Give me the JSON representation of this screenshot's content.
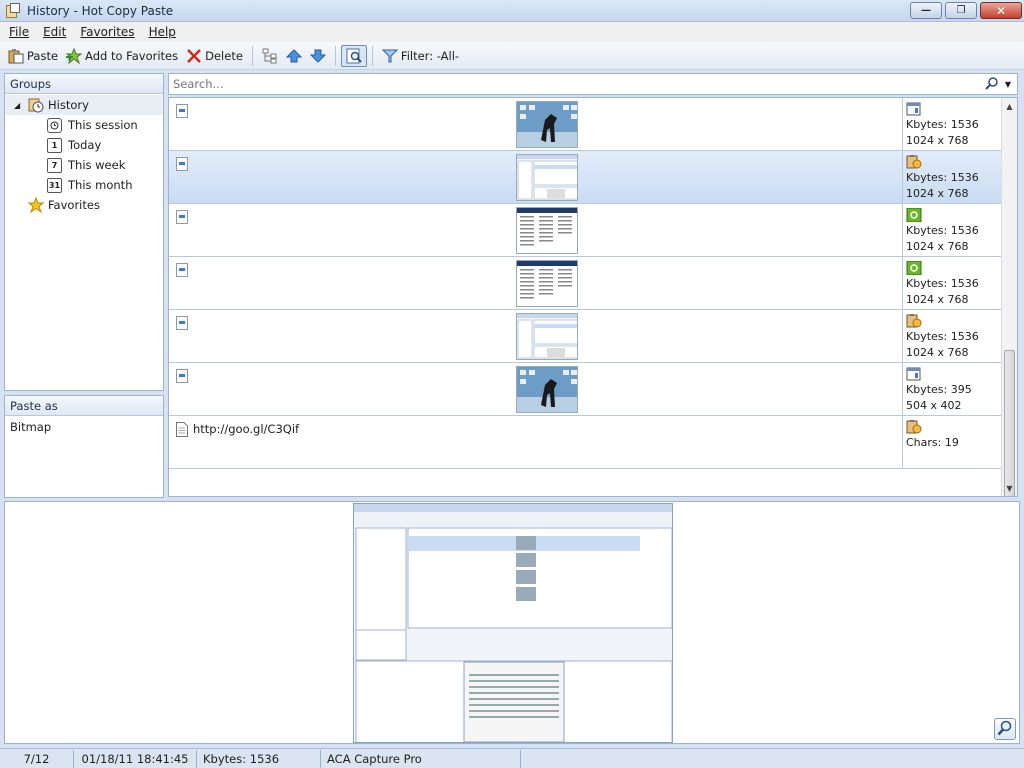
{
  "window": {
    "title": "History - Hot Copy Paste"
  },
  "menu": [
    "File",
    "Edit",
    "Favorites",
    "Help"
  ],
  "toolbar": {
    "paste_label": "Paste",
    "add_favorites_label": "Add to Favorites",
    "delete_label": "Delete",
    "filter_label": "Filter: -All-"
  },
  "groups": {
    "header": "Groups",
    "history_label": "History",
    "items": [
      {
        "label": "This session",
        "badge": ""
      },
      {
        "label": "Today",
        "badge": "1"
      },
      {
        "label": "This week",
        "badge": "7"
      },
      {
        "label": "This month",
        "badge": "31"
      }
    ],
    "favorites_label": "Favorites"
  },
  "paste_as": {
    "header": "Paste as",
    "value": "Bitmap"
  },
  "search": {
    "placeholder": "Search..."
  },
  "rows": [
    {
      "kbytes": "Kbytes: 1536",
      "dims": "1024 x 768",
      "selected": false,
      "type": "horse"
    },
    {
      "kbytes": "Kbytes: 1536",
      "dims": "1024 x 768",
      "selected": true,
      "type": "screen"
    },
    {
      "kbytes": "Kbytes: 1536",
      "dims": "1024 x 768",
      "selected": false,
      "type": "list"
    },
    {
      "kbytes": "Kbytes: 1536",
      "dims": "1024 x 768",
      "selected": false,
      "type": "list"
    },
    {
      "kbytes": "Kbytes: 1536",
      "dims": "1024 x 768",
      "selected": false,
      "type": "screen"
    },
    {
      "kbytes": "Kbytes: 395",
      "dims": "504 x 402",
      "selected": false,
      "type": "horse"
    }
  ],
  "text_row": {
    "text": "http://goo.gl/C3Qif",
    "chars": "Chars: 19"
  },
  "statusbar": {
    "position": "7/12",
    "datetime": "01/18/11 18:41:45",
    "size": "Kbytes: 1536",
    "source": "ACA Capture Pro"
  }
}
